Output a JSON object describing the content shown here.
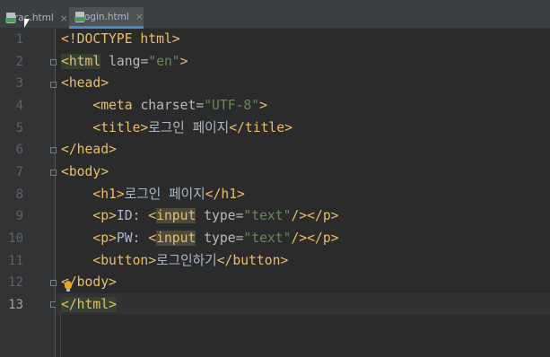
{
  "tabs": [
    {
      "name": "Frac.html",
      "close": "×",
      "active": false
    },
    {
      "name": "login.html",
      "close": "×",
      "active": true
    }
  ],
  "gutter": {
    "line_numbers": [
      "1",
      "2",
      "3",
      "4",
      "5",
      "6",
      "7",
      "8",
      "9",
      "10",
      "11",
      "12",
      "13"
    ],
    "current_line": 13
  },
  "code": {
    "l1": {
      "text": "<!DOCTYPE html>"
    },
    "l2": {
      "lt": "<",
      "tag": "html",
      "sp": " ",
      "attr": "lang",
      "eq": "=",
      "val": "\"en\"",
      "gt": ">"
    },
    "l3": {
      "text": "<head>"
    },
    "l4": {
      "indent": "    ",
      "lt": "<",
      "tag": "meta",
      "sp": " ",
      "attr": "charset",
      "eq": "=",
      "val": "\"UTF-8\"",
      "gt": ">"
    },
    "l5": {
      "indent": "    ",
      "open": "<title>",
      "content": "로그인 페이지",
      "close": "</title>"
    },
    "l6": {
      "text": "</head>"
    },
    "l7": {
      "text": "<body>"
    },
    "l8": {
      "indent": "    ",
      "open": "<h1>",
      "content": "로그인 페이지",
      "close": "</h1>"
    },
    "l9": {
      "indent": "    ",
      "open": "<p>",
      "label": "ID: ",
      "lt": "<",
      "tag": "input",
      "sp": " ",
      "attr": "type",
      "eq": "=",
      "val": "\"text\"",
      "selfclose": "/>",
      "close": "</p>"
    },
    "l10": {
      "indent": "    ",
      "open": "<p>",
      "label": "PW: ",
      "lt": "<",
      "tag": "input",
      "sp": " ",
      "attr": "type",
      "eq": "=",
      "val": "\"text\"",
      "selfclose": "/>",
      "close": "</p>"
    },
    "l11": {
      "indent": "    ",
      "open": "<button>",
      "content": "로그인하기",
      "close": "</button>"
    },
    "l12": {
      "text": "</body>"
    },
    "l13": {
      "text": "</html>"
    }
  },
  "colors": {
    "editor_background": "#2b2b2b",
    "gutter_background": "#313335",
    "tag": "#e8bf6a",
    "attribute": "#bababa",
    "string": "#6a8759",
    "text": "#a9b7c6",
    "tab_underline": "#4a88c7"
  },
  "icons": {
    "tab_file": "html-file-icon",
    "intention": "lightbulb-icon",
    "fold": "fold-marker-icon"
  }
}
